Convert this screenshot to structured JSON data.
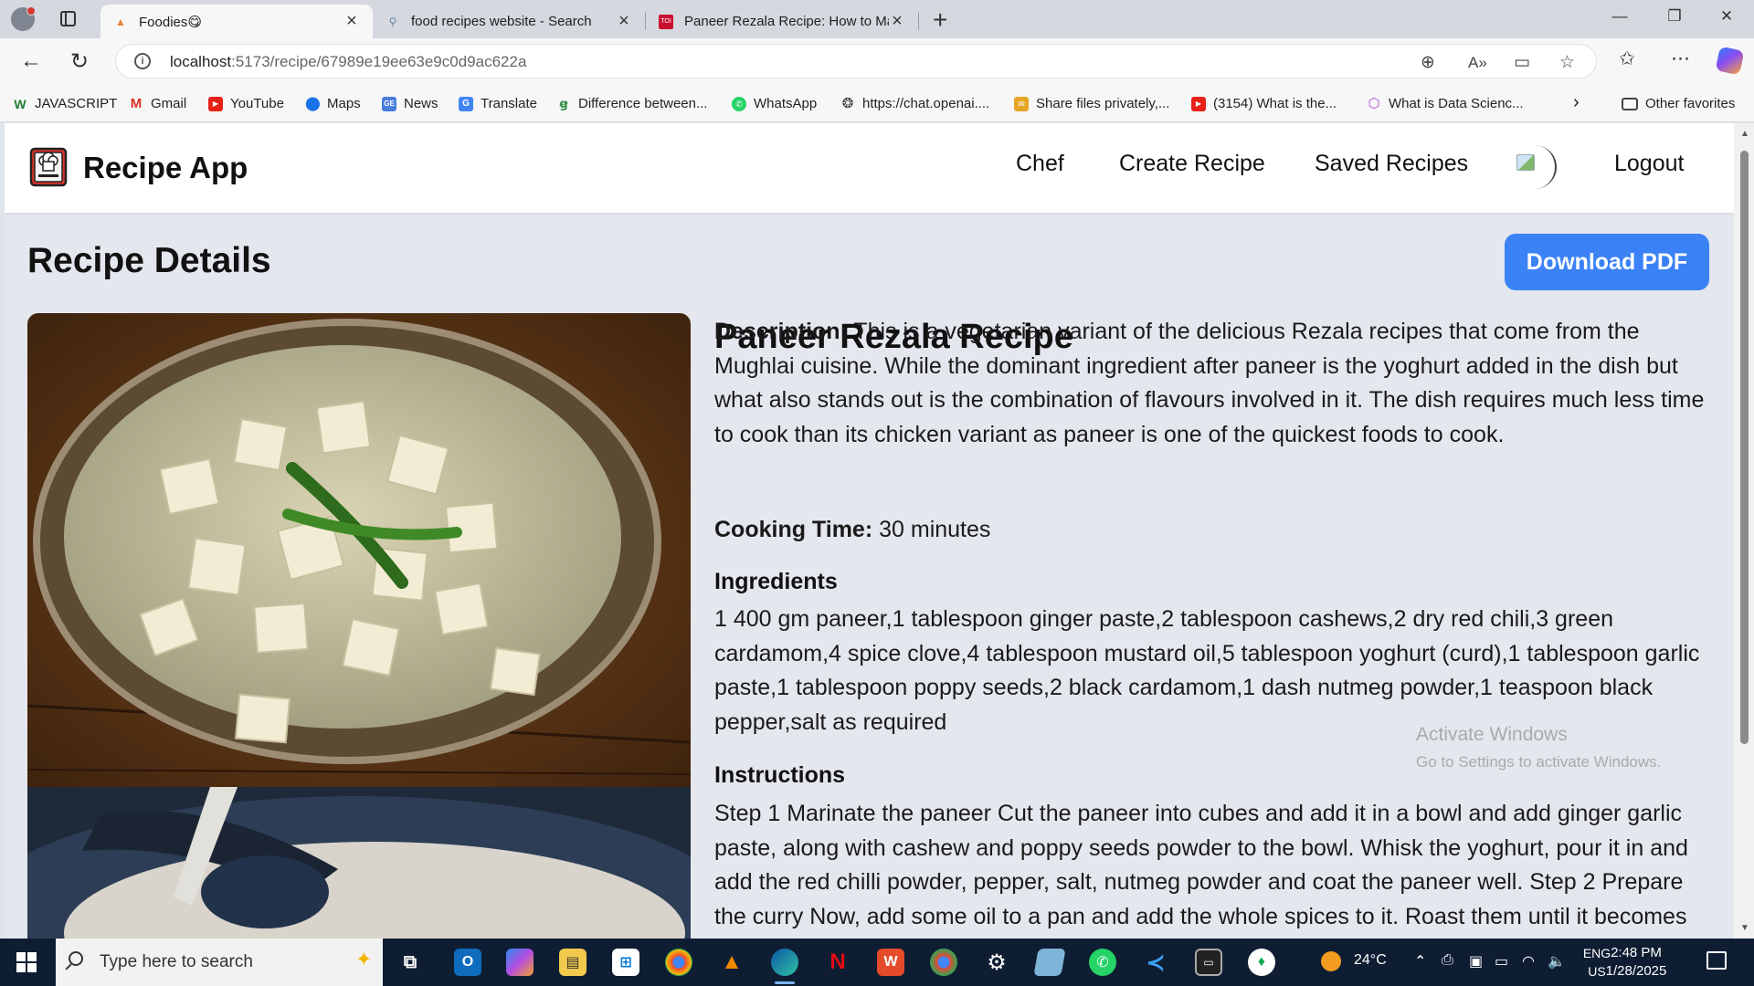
{
  "browser": {
    "tabs": [
      {
        "title": "Foodies😋",
        "active": true
      },
      {
        "title": "food recipes website - Search",
        "active": false
      },
      {
        "title": "Paneer Rezala Recipe: How to Mal",
        "active": false
      }
    ],
    "url_host": "localhost",
    "url_path": ":5173/recipe/67989e19ee63e9c0d9ac622a",
    "bookmarks": [
      {
        "label": "JAVASCRIPT",
        "icon": "w-icon"
      },
      {
        "label": "Gmail",
        "icon": "gmail-icon"
      },
      {
        "label": "YouTube",
        "icon": "youtube-icon"
      },
      {
        "label": "Maps",
        "icon": "maps-icon"
      },
      {
        "label": "News",
        "icon": "news-icon"
      },
      {
        "label": "Translate",
        "icon": "translate-icon"
      },
      {
        "label": "Difference between...",
        "icon": "gfg-icon"
      },
      {
        "label": "WhatsApp",
        "icon": "whatsapp-icon"
      },
      {
        "label": "https://chat.openai....",
        "icon": "openai-icon"
      },
      {
        "label": "Share files privately,...",
        "icon": "share-icon"
      },
      {
        "label": "(3154) What is the...",
        "icon": "youtube-icon"
      },
      {
        "label": "What is Data Scienc...",
        "icon": "cube-icon"
      }
    ],
    "other_favorites": "Other favorites"
  },
  "app": {
    "brand": "Recipe App",
    "nav": {
      "chef": "Chef",
      "create": "Create Recipe",
      "saved": "Saved Recipes",
      "logout": "Logout"
    },
    "page_title": "Recipe Details",
    "download_label": "Download PDF"
  },
  "recipe": {
    "title": "Paneer Rezala Recipe",
    "description_label": "Description:",
    "description": " This is a vegetarian variant of the delicious Rezala recipes that come from the Mughlai cuisine. While the dominant ingredient after paneer is the yoghurt added in the dish but what also stands out is the combination of flavours involved in it. The dish requires much less time to cook than its chicken variant as paneer is one of the quickest foods to cook.",
    "cooking_time_label": "Cooking Time:",
    "cooking_time": " 30 minutes",
    "ingredients_heading": "Ingredients",
    "ingredients": "1 400 gm paneer,1 tablespoon ginger paste,2 tablespoon cashews,2 dry red chili,3 green cardamom,4 spice clove,4 tablespoon mustard oil,5 tablespoon yoghurt (curd),1 tablespoon garlic paste,1 tablespoon poppy seeds,2 black cardamom,1 dash nutmeg powder,1 teaspoon black pepper,salt as required",
    "instructions_heading": "Instructions",
    "instructions": "Step 1 Marinate the paneer Cut the paneer into cubes and add it in a bowl and add ginger garlic paste, along with cashew and poppy seeds powder to the bowl. Whisk the yoghurt, pour it in and add the red chilli powder, pepper, salt, nutmeg powder and coat the paneer well. Step 2 Prepare the curry Now, add some oil to a pan and add the whole spices to it. Roast them until it becomes"
  },
  "watermark": {
    "line1": "Activate Windows",
    "line2": "Go to Settings to activate Windows."
  },
  "taskbar": {
    "search_placeholder": "Type here to search",
    "temperature": "24°C",
    "lang1": "ENG",
    "lang2": "US",
    "time": "2:48 PM",
    "date": "1/28/2025"
  },
  "colors": {
    "accent": "#3b82f6",
    "page_bg": "#e4e7ed",
    "taskbar": "#0f1d33"
  }
}
